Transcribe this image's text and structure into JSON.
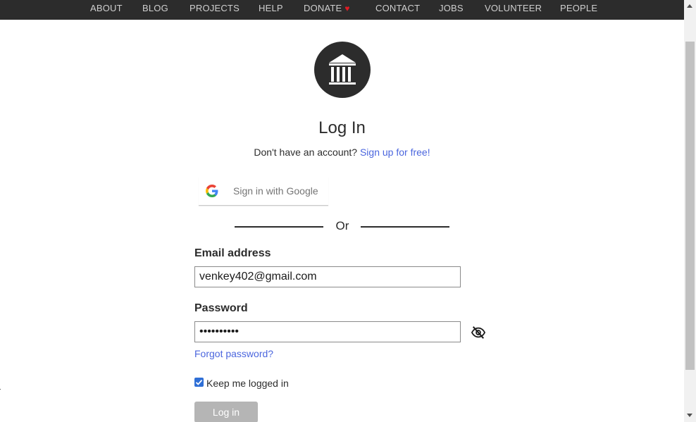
{
  "nav": {
    "items": [
      {
        "label": "ABOUT"
      },
      {
        "label": "BLOG"
      },
      {
        "label": "PROJECTS"
      },
      {
        "label": "HELP"
      },
      {
        "label": "DONATE"
      },
      {
        "label": "CONTACT"
      },
      {
        "label": "JOBS"
      },
      {
        "label": "VOLUNTEER"
      },
      {
        "label": "PEOPLE"
      }
    ],
    "donate_icon": "heart-icon"
  },
  "logo": {
    "icon": "institution-building-icon"
  },
  "login": {
    "title": "Log In",
    "no_account_text": "Don't have an account?",
    "signup_link": "Sign up for free",
    "signup_suffix": "!",
    "google_button_label": "Sign in with Google",
    "or_label": "Or",
    "email_label": "Email address",
    "email_value": "venkey402@gmail.com",
    "password_label": "Password",
    "password_value": "••••••••••",
    "forgot_link": "Forgot password?",
    "keep_logged_in_label": "Keep me logged in",
    "keep_logged_in_checked": true,
    "login_button": "Log in"
  },
  "colors": {
    "nav_bg": "#2c2c2c",
    "link": "#4b66de",
    "donate_heart": "#e01b24",
    "login_button_bg": "#b5b5b5",
    "checkbox": "#2f6fd6"
  }
}
